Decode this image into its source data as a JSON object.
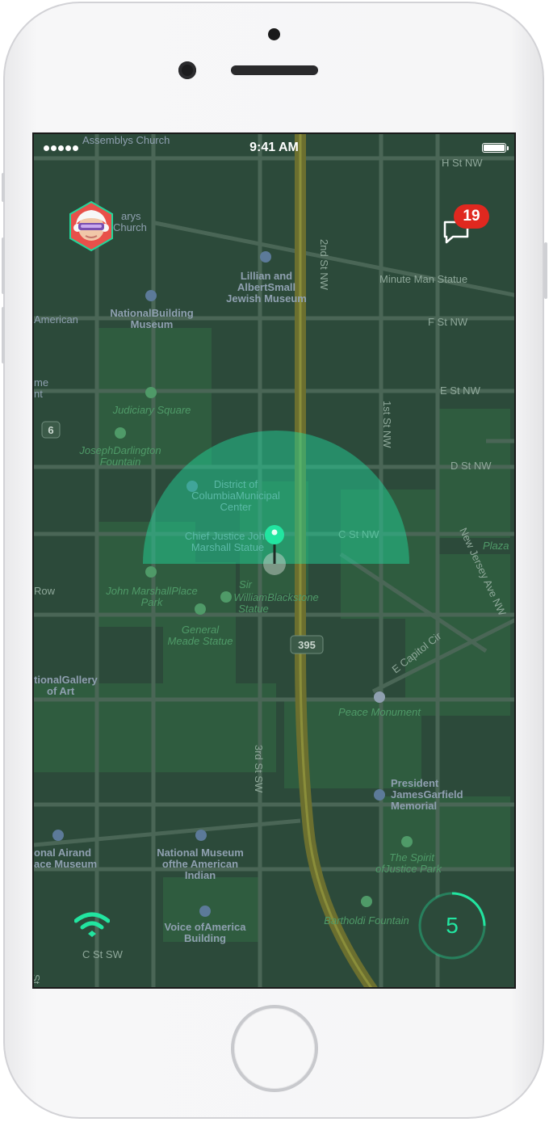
{
  "status_bar": {
    "time": "9:41 AM",
    "signal_dots": 5,
    "battery_level": 1.0
  },
  "header": {
    "avatar_icon": "user-avatar-vr-goggles",
    "messages_icon": "chat-bubble-icon",
    "notification_count": "19"
  },
  "map": {
    "street_labels": {
      "h_st": "H St NW",
      "f_st": "F St NW",
      "e_st": "E St NW",
      "d_st": "D St NW",
      "c_st": "C St NW",
      "second_st": "2nd St NW",
      "first_st": "1st St NW",
      "third_st": "3rd St SW",
      "nj_ave": "New Jersey Ave NW",
      "e_capitol": "E Capitol Cir",
      "c_st_sw": "C St SW",
      "route_6": "6",
      "route_395": "395",
      "plaza": "Plaza",
      "american": "American",
      "me": "me",
      "nt": "nt",
      "row": "Row",
      "st_sw": "St SW"
    },
    "poi_labels": {
      "assembly": "Assemblys Church",
      "marys_1": "arys",
      "marys_2": "Church",
      "lillian_1": "Lillian and",
      "lillian_2": "AlbertSmall",
      "lillian_3": "Jewish Museum",
      "minuteman": "Minute Man Statue",
      "building_museum_1": "NationalBuilding",
      "building_museum_2": "Museum",
      "judiciary": "Judiciary Square",
      "darlington_1": "JosephDarlington",
      "darlington_2": "Fountain",
      "municipal_1": "District of",
      "municipal_2": "ColumbiaMunicipal",
      "municipal_3": "Center",
      "marshall_statue_1": "Chief Justice John",
      "marshall_statue_2": "Marshall Statue",
      "marshall_park_1": "John MarshallPlace",
      "marshall_park_2": "Park",
      "blackstone_1": "Sir",
      "blackstone_2": "WilliamBlackstone",
      "blackstone_3": "Statue",
      "meade_1": "General",
      "meade_2": "Meade Statue",
      "gallery_1": "tionalGallery",
      "gallery_2": "of Art",
      "peace": "Peace Monument",
      "garfield_1": "President",
      "garfield_2": "JamesGarfield",
      "garfield_3": "Memorial",
      "spirit_1": "The Spirit",
      "spirit_2": "ofJustice Park",
      "airspace_1": "onal Airand",
      "airspace_2": "ace Museum",
      "american_indian_1": "National Museum",
      "american_indian_2": "ofthe American",
      "american_indian_3": "Indian",
      "voa_1": "Voice ofAmerica",
      "voa_2": "Building",
      "bartholdi": "Bartholdi Fountain"
    }
  },
  "overlay": {
    "location_pin_icon": "location-pin-icon",
    "scan_arc_color": "#22d69a",
    "wifi_icon": "wifi-icon",
    "timer_value": "5",
    "timer_progress": 0.25,
    "accent_color": "#22e5a0"
  }
}
